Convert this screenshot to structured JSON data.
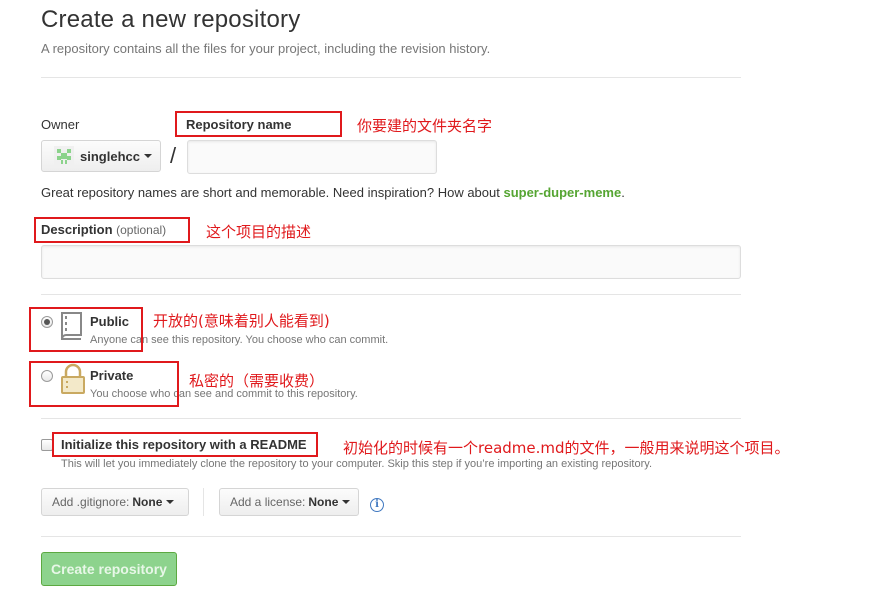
{
  "header": {
    "title": "Create a new repository",
    "subtitle": "A repository contains all the files for your project, including the revision history."
  },
  "owner": {
    "label": "Owner",
    "value": "singlehcc"
  },
  "repo_name": {
    "label": "Repository name",
    "value": ""
  },
  "hint": {
    "prefix": "Great repository names are short and memorable. Need inspiration? How about ",
    "suggestion": "super-duper-meme",
    "suffix": "."
  },
  "description": {
    "label": "Description",
    "optional": "(optional)",
    "value": ""
  },
  "visibility": {
    "public": {
      "title": "Public",
      "desc": "Anyone can see this repository. You choose who can commit.",
      "checked": true
    },
    "private": {
      "title": "Private",
      "desc": "You choose who can see and commit to this repository.",
      "checked": false
    }
  },
  "readme": {
    "label": "Initialize this repository with a README",
    "desc": "This will let you immediately clone the repository to your computer. Skip this step if you’re importing an existing repository.",
    "checked": false
  },
  "gitignore": {
    "label": "Add .gitignore:",
    "value": "None"
  },
  "license": {
    "label": "Add a license:",
    "value": "None"
  },
  "submit": {
    "label": "Create repository"
  },
  "annotations": {
    "repo_name": "你要建的文件夹名字",
    "description": "这个项目的描述",
    "public": "开放的(意味着别人能看到)",
    "private": "私密的（需要收费）",
    "readme": "初始化的时候有一个readme.md的文件，一般用来说明这个项目。"
  },
  "colors": {
    "annotation_red": "#e0191c",
    "button_green": "#8dd38d",
    "suggestion_green": "#55a532",
    "link_blue": "#4078c0"
  },
  "icons": {
    "owner_avatar": "identicon-icon",
    "public": "repo-book-icon",
    "private": "lock-icon",
    "info": "info-icon"
  }
}
